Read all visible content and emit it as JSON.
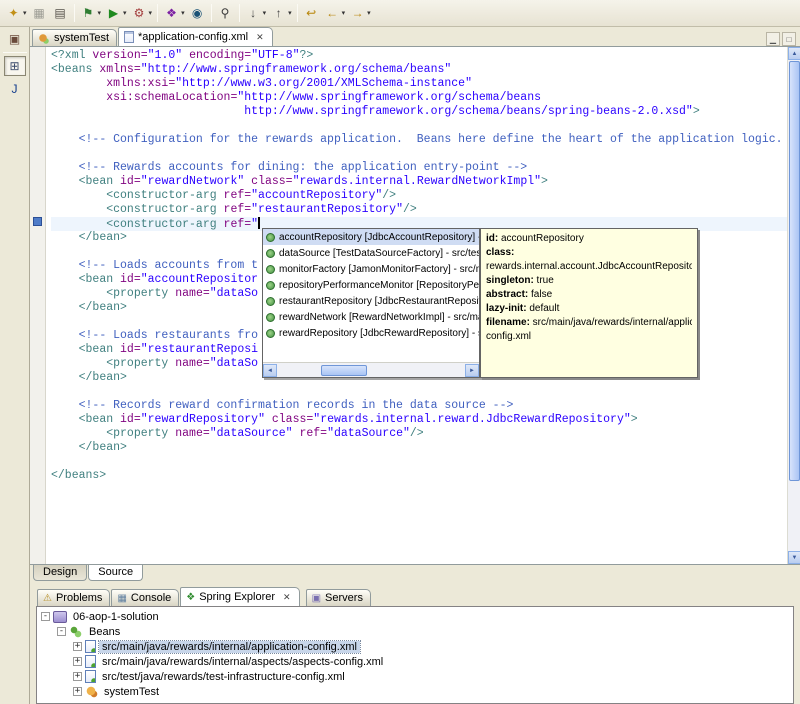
{
  "colors": {
    "chrome_bg": "#ece9d8",
    "tooltip_bg": "#ffffe1",
    "selection": "#cfdcf3",
    "tree_selection": "#c8d6ea"
  },
  "toolbar": {
    "items": [
      {
        "name": "new-wizard",
        "glyph": "✦",
        "color": "#c29017",
        "dd": true
      },
      {
        "name": "save",
        "glyph": "▦",
        "color": "#9b9b93"
      },
      {
        "name": "print",
        "glyph": "▤",
        "color": "#55514a"
      },
      {
        "sep": true
      },
      {
        "name": "debug",
        "glyph": "⚑",
        "color": "#2e7d32",
        "dd": true
      },
      {
        "name": "run",
        "glyph": "▶",
        "color": "#1f8a1f",
        "dd": true
      },
      {
        "name": "external-tools",
        "glyph": "⚙",
        "color": "#a33c3c",
        "dd": true
      },
      {
        "sep": true
      },
      {
        "name": "new-web-service",
        "glyph": "❖",
        "color": "#7b1fa2",
        "dd": true
      },
      {
        "name": "web-browser",
        "glyph": "◉",
        "color": "#1a5276"
      },
      {
        "sep": true
      },
      {
        "name": "search",
        "glyph": "⚲",
        "color": "#3a3a3a"
      },
      {
        "sep": true
      },
      {
        "name": "next-annotation",
        "glyph": "↓",
        "color": "#444444",
        "dd": true
      },
      {
        "name": "previous-annotation",
        "glyph": "↑",
        "color": "#444444",
        "dd": true
      },
      {
        "sep": true
      },
      {
        "name": "last-edit-location",
        "glyph": "↩",
        "color": "#b8860b"
      },
      {
        "name": "back",
        "glyph": "←",
        "color": "#b8860b",
        "dd": true
      },
      {
        "name": "forward",
        "glyph": "→",
        "color": "#b8860b",
        "dd": true
      }
    ]
  },
  "left_strip": {
    "items": [
      {
        "name": "restore-view",
        "glyph": "▣",
        "color": "#6a4a3a",
        "pressed": false
      },
      {
        "name": "open-perspective",
        "glyph": "⊞",
        "color": "#3a4a6a",
        "pressed": true
      },
      {
        "name": "java-ee-perspective",
        "glyph": "J",
        "color": "#123c8c",
        "pressed": false
      }
    ]
  },
  "editor": {
    "tabs": [
      {
        "name": "systemtest",
        "icon": "bean",
        "label": "systemTest",
        "active": false,
        "closable": false
      },
      {
        "name": "application-config",
        "icon": "xmlfile",
        "label": "*application-config.xml",
        "active": true,
        "closable": true
      }
    ],
    "minmax": [
      {
        "name": "minimize",
        "glyph": "▁"
      },
      {
        "name": "maximize",
        "glyph": "□"
      }
    ],
    "current_line": 12,
    "close_glyph": "✕",
    "code_lines": [
      [
        {
          "t": "<?xml ",
          "c": "tag"
        },
        {
          "t": "version=",
          "c": "attr"
        },
        {
          "t": "\"1.0\" ",
          "c": "val"
        },
        {
          "t": "encoding=",
          "c": "attr"
        },
        {
          "t": "\"UTF-8\"",
          "c": "val"
        },
        {
          "t": "?>",
          "c": "tag"
        }
      ],
      [
        {
          "t": "<beans ",
          "c": "tag"
        },
        {
          "t": "xmlns=",
          "c": "attr"
        },
        {
          "t": "\"http://www.springframework.org/schema/beans\"",
          "c": "val"
        }
      ],
      [
        {
          "t": "        ",
          "c": "txt"
        },
        {
          "t": "xmlns:xsi=",
          "c": "attr"
        },
        {
          "t": "\"http://www.w3.org/2001/XMLSchema-instance\"",
          "c": "val"
        }
      ],
      [
        {
          "t": "        ",
          "c": "txt"
        },
        {
          "t": "xsi:schemaLocation=",
          "c": "attr"
        },
        {
          "t": "\"http://www.springframework.org/schema/beans",
          "c": "val"
        }
      ],
      [
        {
          "t": "                            ",
          "c": "txt"
        },
        {
          "t": "http://www.springframework.org/schema/beans/spring-beans-2.0.xsd\"",
          "c": "val"
        },
        {
          "t": ">",
          "c": "tag"
        }
      ],
      [],
      [
        {
          "t": "    ",
          "c": "txt"
        },
        {
          "t": "<!-- Configuration for the rewards application.  Beans here define the heart of the application logic. -->",
          "c": "com"
        }
      ],
      [],
      [
        {
          "t": "    ",
          "c": "txt"
        },
        {
          "t": "<!-- Rewards accounts for dining: the application entry-point -->",
          "c": "com"
        }
      ],
      [
        {
          "t": "    ",
          "c": "txt"
        },
        {
          "t": "<bean ",
          "c": "tag"
        },
        {
          "t": "id=",
          "c": "attr"
        },
        {
          "t": "\"rewardNetwork\" ",
          "c": "val"
        },
        {
          "t": "class=",
          "c": "attr"
        },
        {
          "t": "\"rewards.internal.RewardNetworkImpl\"",
          "c": "val"
        },
        {
          "t": ">",
          "c": "tag"
        }
      ],
      [
        {
          "t": "        ",
          "c": "txt"
        },
        {
          "t": "<constructor-arg ",
          "c": "tag"
        },
        {
          "t": "ref=",
          "c": "attr"
        },
        {
          "t": "\"accountRepository\"",
          "c": "val"
        },
        {
          "t": "/>",
          "c": "tag"
        }
      ],
      [
        {
          "t": "        ",
          "c": "txt"
        },
        {
          "t": "<constructor-arg ",
          "c": "tag"
        },
        {
          "t": "ref=",
          "c": "attr"
        },
        {
          "t": "\"restaurantRepository\"",
          "c": "val"
        },
        {
          "t": "/>",
          "c": "tag"
        }
      ],
      [
        {
          "t": "        ",
          "c": "txt"
        },
        {
          "t": "<constructor-arg ",
          "c": "tag"
        },
        {
          "t": "ref=",
          "c": "attr"
        },
        {
          "t": "\"",
          "c": "val"
        },
        {
          "t": "",
          "c": "caret"
        }
      ],
      [
        {
          "t": "    ",
          "c": "txt"
        },
        {
          "t": "</bean>",
          "c": "tag"
        }
      ],
      [],
      [
        {
          "t": "    ",
          "c": "txt"
        },
        {
          "t": "<!-- Loads accounts from t",
          "c": "com"
        }
      ],
      [
        {
          "t": "    ",
          "c": "txt"
        },
        {
          "t": "<bean ",
          "c": "tag"
        },
        {
          "t": "id=",
          "c": "attr"
        },
        {
          "t": "\"accountRepositor",
          "c": "val"
        }
      ],
      [
        {
          "t": "        ",
          "c": "txt"
        },
        {
          "t": "<property ",
          "c": "tag"
        },
        {
          "t": "name=",
          "c": "attr"
        },
        {
          "t": "\"dataSo",
          "c": "val"
        }
      ],
      [
        {
          "t": "    ",
          "c": "txt"
        },
        {
          "t": "</bean>",
          "c": "tag"
        }
      ],
      [],
      [
        {
          "t": "    ",
          "c": "txt"
        },
        {
          "t": "<!-- Loads restaurants fro",
          "c": "com"
        }
      ],
      [
        {
          "t": "    ",
          "c": "txt"
        },
        {
          "t": "<bean ",
          "c": "tag"
        },
        {
          "t": "id=",
          "c": "attr"
        },
        {
          "t": "\"restaurantReposi",
          "c": "val"
        }
      ],
      [
        {
          "t": "        ",
          "c": "txt"
        },
        {
          "t": "<property ",
          "c": "tag"
        },
        {
          "t": "name=",
          "c": "attr"
        },
        {
          "t": "\"dataSo",
          "c": "val"
        }
      ],
      [
        {
          "t": "    ",
          "c": "txt"
        },
        {
          "t": "</bean>",
          "c": "tag"
        }
      ],
      [],
      [
        {
          "t": "    ",
          "c": "txt"
        },
        {
          "t": "<!-- Records reward confirmation records in the data source -->",
          "c": "com"
        }
      ],
      [
        {
          "t": "    ",
          "c": "txt"
        },
        {
          "t": "<bean ",
          "c": "tag"
        },
        {
          "t": "id=",
          "c": "attr"
        },
        {
          "t": "\"rewardRepository\" ",
          "c": "val"
        },
        {
          "t": "class=",
          "c": "attr"
        },
        {
          "t": "\"rewards.internal.reward.JdbcRewardRepository\"",
          "c": "val"
        },
        {
          "t": ">",
          "c": "tag"
        }
      ],
      [
        {
          "t": "        ",
          "c": "txt"
        },
        {
          "t": "<property ",
          "c": "tag"
        },
        {
          "t": "name=",
          "c": "attr"
        },
        {
          "t": "\"dataSource\" ",
          "c": "val"
        },
        {
          "t": "ref=",
          "c": "attr"
        },
        {
          "t": "\"dataSource\"",
          "c": "val"
        },
        {
          "t": "/>",
          "c": "tag"
        }
      ],
      [
        {
          "t": "    ",
          "c": "txt"
        },
        {
          "t": "</bean>",
          "c": "tag"
        }
      ],
      [],
      [
        {
          "t": "</beans>",
          "c": "tag"
        }
      ]
    ],
    "bottom_tabs": [
      "Design",
      "Source"
    ],
    "active_bottom_tab": "Source"
  },
  "popup": {
    "selected_index": 0,
    "items": [
      "accountRepository [JdbcAccountRepository] - src/",
      "dataSource [TestDataSourceFactory] - src/test/ja",
      "monitorFactory [JamonMonitorFactory] - src/main",
      "repositoryPerformanceMonitor [RepositoryPerfor",
      "restaurantRepository [JdbcRestaurantRepository",
      "rewardNetwork [RewardNetworkImpl] - src/main/j",
      "rewardRepository [JdbcRewardRepository] - src/r"
    ]
  },
  "tooltip": {
    "rows": [
      {
        "label": "id:",
        "value": " accountRepository"
      },
      {
        "label": "class:",
        "value": ""
      },
      {
        "label": "",
        "value": "rewards.internal.account.JdbcAccountRepository"
      },
      {
        "label": "singleton:",
        "value": " true"
      },
      {
        "label": "abstract:",
        "value": " false"
      },
      {
        "label": "lazy-init:",
        "value": " default"
      },
      {
        "label": "filename:",
        "value": " src/main/java/rewards/internal/application-"
      },
      {
        "label": "",
        "value": "config.xml"
      }
    ]
  },
  "bottom_panel": {
    "tabs": [
      {
        "name": "problems",
        "icon_glyph": "⚠",
        "icon_color": "#b8912a",
        "label": "Problems",
        "active": false,
        "closable": false,
        "gap": false
      },
      {
        "name": "console",
        "icon_glyph": "▦",
        "icon_color": "#5f7f9f",
        "label": "Console",
        "active": false,
        "closable": false,
        "gap": false
      },
      {
        "name": "spring-explorer",
        "icon_glyph": "❖",
        "icon_color": "#2e8b2e",
        "label": "Spring Explorer",
        "active": true,
        "closable": true,
        "gap": false
      },
      {
        "name": "servers",
        "icon_glyph": "▣",
        "icon_color": "#7a6fb0",
        "label": "Servers",
        "active": false,
        "closable": false,
        "gap": true
      }
    ],
    "tree": [
      {
        "level": 0,
        "expander": "-",
        "icon": "project",
        "label": "06-aop-1-solution",
        "selected": false
      },
      {
        "level": 1,
        "expander": "-",
        "icon": "beans",
        "label": "Beans",
        "selected": false
      },
      {
        "level": 2,
        "expander": "+",
        "icon": "config",
        "label": "src/main/java/rewards/internal/application-config.xml",
        "selected": true
      },
      {
        "level": 2,
        "expander": "+",
        "icon": "config",
        "label": "src/main/java/rewards/internal/aspects/aspects-config.xml",
        "selected": false
      },
      {
        "level": 2,
        "expander": "+",
        "icon": "config",
        "label": "src/test/java/rewards/test-infrastructure-config.xml",
        "selected": false
      },
      {
        "level": 2,
        "expander": "+",
        "icon": "bean",
        "label": "systemTest",
        "selected": false
      }
    ]
  }
}
